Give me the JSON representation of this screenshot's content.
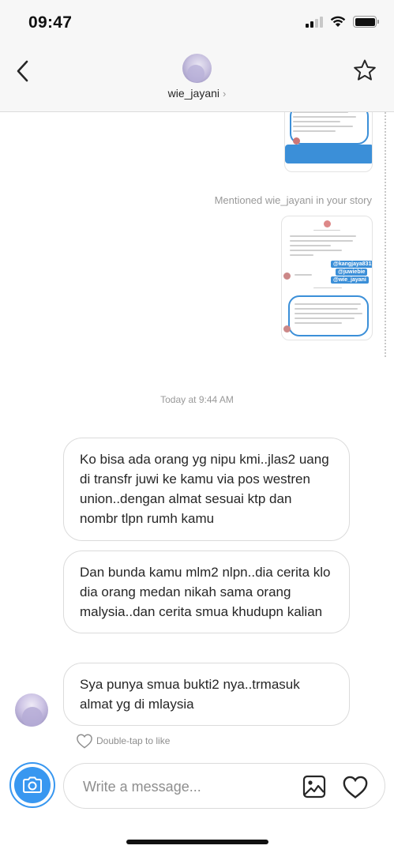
{
  "status_bar": {
    "time": "09:47"
  },
  "header": {
    "username": "wie_jayani",
    "chevron": "›",
    "icons": [
      "back-chevron-icon",
      "star-icon"
    ]
  },
  "thread": {
    "story_reply_caption": "Mentioned wie_jayani in your story",
    "story_tags": [
      "@kangjaya831",
      "@juwiebie",
      "@wie_jayani"
    ],
    "timestamp": "Today at 9:44 AM",
    "messages": [
      {
        "text": "Ko bisa ada orang yg nipu kmi..jlas2 uang di transfr juwi ke kamu via pos westren union..dengan almat sesuai ktp dan nombr tlpn rumh kamu"
      },
      {
        "text": "Dan bunda kamu mlm2 nlpn..dia cerita klo dia orang medan nikah sama orang malysia..dan cerita smua khudupn kalian"
      },
      {
        "text": "Sya punya smua bukti2 nya..trmasuk almat yg di mlaysia"
      }
    ],
    "like_hint": "Double-tap to like"
  },
  "composer": {
    "placeholder": "Write a message...",
    "icons": [
      "camera-icon",
      "gallery-icon",
      "heart-icon"
    ]
  },
  "colors": {
    "accent": "#3897f0",
    "border": "#dbdbdb",
    "muted_text": "#8e8e8e"
  }
}
